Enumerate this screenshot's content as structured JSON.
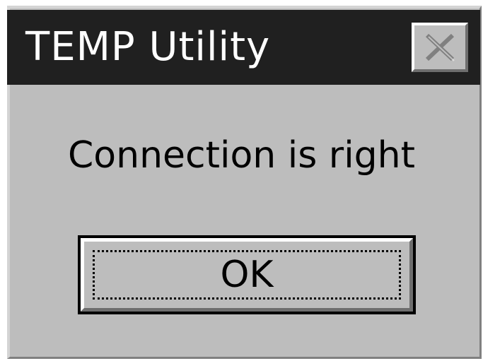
{
  "window": {
    "title": "TEMP Utility",
    "close_icon": "close-icon"
  },
  "dialog": {
    "message": "Connection is right",
    "ok_label": "OK"
  },
  "colors": {
    "titlebar": "#202020",
    "title_text": "#ffffff",
    "dialog_bg": "#bdbdbd",
    "text": "#000000"
  }
}
